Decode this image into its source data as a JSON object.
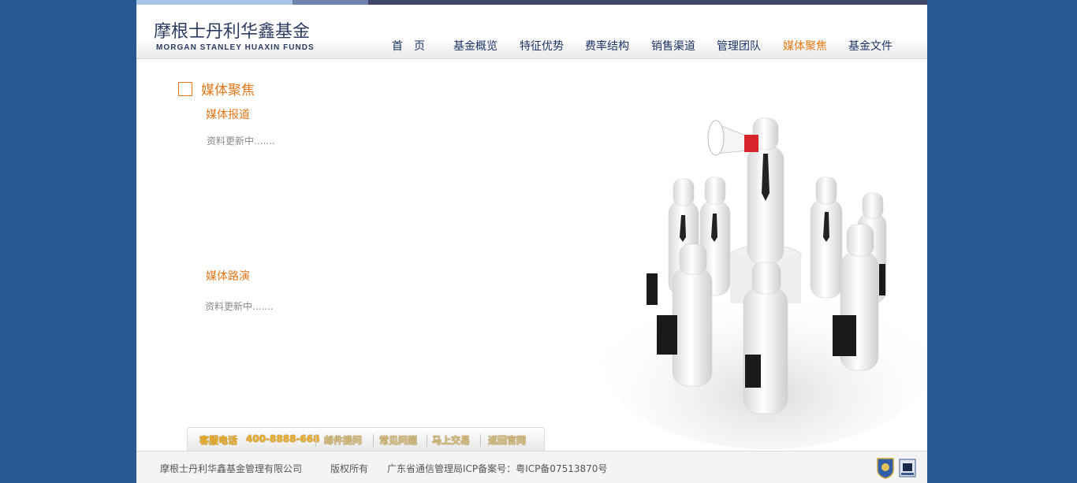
{
  "header": {
    "logo_cn": "摩根士丹利华鑫基金",
    "logo_en": "MORGAN STANLEY HUAXIN FUNDS"
  },
  "nav": [
    {
      "label": "首　页",
      "active": false
    },
    {
      "label": "基金概览",
      "active": false
    },
    {
      "label": "特征优势",
      "active": false
    },
    {
      "label": "费率结构",
      "active": false
    },
    {
      "label": "销售渠道",
      "active": false
    },
    {
      "label": "管理团队",
      "active": false
    },
    {
      "label": "媒体聚焦",
      "active": true
    },
    {
      "label": "基金文件",
      "active": false
    }
  ],
  "main": {
    "section_title": "媒体聚焦",
    "media_reports_title": "媒体报道",
    "media_reports_note": "资料更新中.......",
    "media_roadshow_title": "媒体路演",
    "media_roadshow_note": "资料更新中......."
  },
  "footer_links": {
    "hotline_label": "客服电话",
    "hotline_number": "400-8888-668",
    "mail": "邮件提问",
    "faq": "常见问题",
    "trade": "马上交易",
    "home": "返回官网"
  },
  "footer": {
    "company": "摩根士丹利华鑫基金管理有限公司",
    "rights": "版权所有",
    "icp": "广东省通信管理局ICP备案号：粤ICP备07513870号"
  },
  "colors": {
    "background": "#285992",
    "accent": "#e6781a",
    "nav_text": "#1c3367"
  }
}
